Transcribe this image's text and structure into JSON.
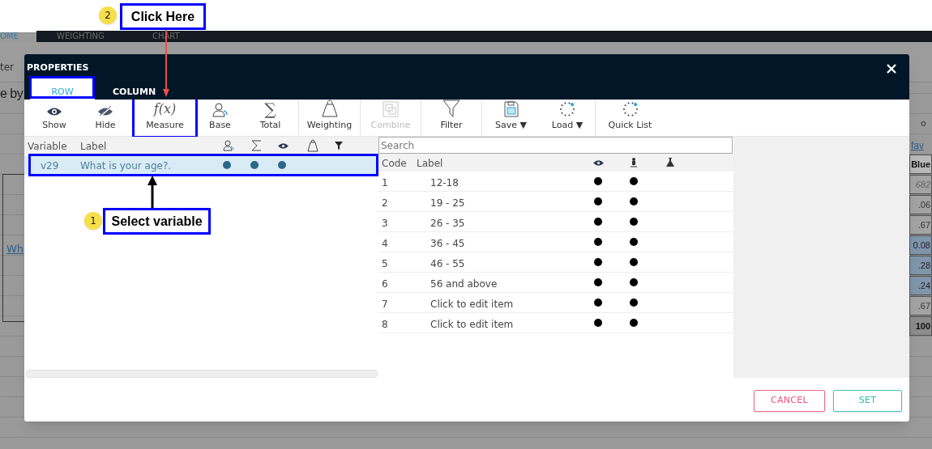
{
  "background": {
    "tabs": [
      {
        "label": "OME",
        "selected": true
      },
      {
        "label": "WEIGHTING",
        "selected": false
      },
      {
        "label": "CHART",
        "selected": false
      }
    ],
    "toolbar_label": "ter",
    "heading": "e by",
    "link": "Wh",
    "column_header": "o",
    "legend_link": "fav",
    "table_cells": [
      {
        "text": "Blue",
        "kind": "header"
      },
      {
        "text": "682",
        "kind": "italic"
      },
      {
        "text": ".06",
        "kind": "plain"
      },
      {
        "text": ".67",
        "kind": "plain"
      },
      {
        "text": "0.08",
        "kind": "highlight"
      },
      {
        "text": ".28",
        "kind": "highlight"
      },
      {
        "text": ".24",
        "kind": "highlight"
      },
      {
        "text": ".67",
        "kind": "plain"
      },
      {
        "text": "100",
        "kind": "total"
      }
    ]
  },
  "dialog": {
    "title": "PROPERTIES",
    "tabs": [
      {
        "label": "ROW",
        "selected": true
      },
      {
        "label": "COLUMN",
        "selected": false
      }
    ],
    "toolbar": [
      {
        "label": "Show",
        "disabled": false,
        "separator_before": false
      },
      {
        "label": "Hide",
        "disabled": false,
        "separator_before": false
      },
      {
        "label": "Measure",
        "icon_text": "f(x)",
        "disabled": false,
        "separator_before": false
      },
      {
        "label": "Base",
        "disabled": false,
        "separator_before": false
      },
      {
        "label": "Total",
        "icon_text": "∑",
        "disabled": false,
        "separator_before": false
      },
      {
        "label": "Weighting",
        "disabled": false,
        "separator_before": true
      },
      {
        "label": "Combine",
        "disabled": true,
        "separator_before": true
      },
      {
        "label": "Filter",
        "disabled": false,
        "separator_before": true
      },
      {
        "label": "Save ▼",
        "disabled": false,
        "separator_before": true
      },
      {
        "label": "Load ▼",
        "disabled": false,
        "separator_before": false
      },
      {
        "label": "Quick List",
        "disabled": false,
        "separator_before": true
      }
    ],
    "variables": {
      "columns": [
        "Variable",
        "Label"
      ],
      "rows": [
        {
          "variable": "v29",
          "label": "What is your age?.",
          "selected": true,
          "base": true,
          "total": true,
          "shown": true,
          "weighted": false,
          "filtered": false
        }
      ]
    },
    "codes": {
      "search_placeholder": "Search",
      "columns": [
        "Code",
        "Label"
      ],
      "rows": [
        {
          "code": "1",
          "label": "12-18",
          "shown": true,
          "flagged": true
        },
        {
          "code": "2",
          "label": "19 - 25",
          "shown": true,
          "flagged": true
        },
        {
          "code": "3",
          "label": "26 - 35",
          "shown": true,
          "flagged": true
        },
        {
          "code": "4",
          "label": "36 - 45",
          "shown": true,
          "flagged": true
        },
        {
          "code": "5",
          "label": "46 - 55",
          "shown": true,
          "flagged": true
        },
        {
          "code": "6",
          "label": "56 and above",
          "shown": true,
          "flagged": true
        },
        {
          "code": "7",
          "label": "Click to edit item",
          "shown": true,
          "flagged": true
        },
        {
          "code": "8",
          "label": "Click to edit item",
          "shown": true,
          "flagged": true
        }
      ]
    },
    "buttons": [
      {
        "label": "CANCEL",
        "kind": "cancel"
      },
      {
        "label": "SET",
        "kind": "confirm"
      }
    ]
  },
  "annotations": [
    {
      "number": "2",
      "text": "Click Here"
    },
    {
      "number": "1",
      "text": "Select variable"
    }
  ]
}
